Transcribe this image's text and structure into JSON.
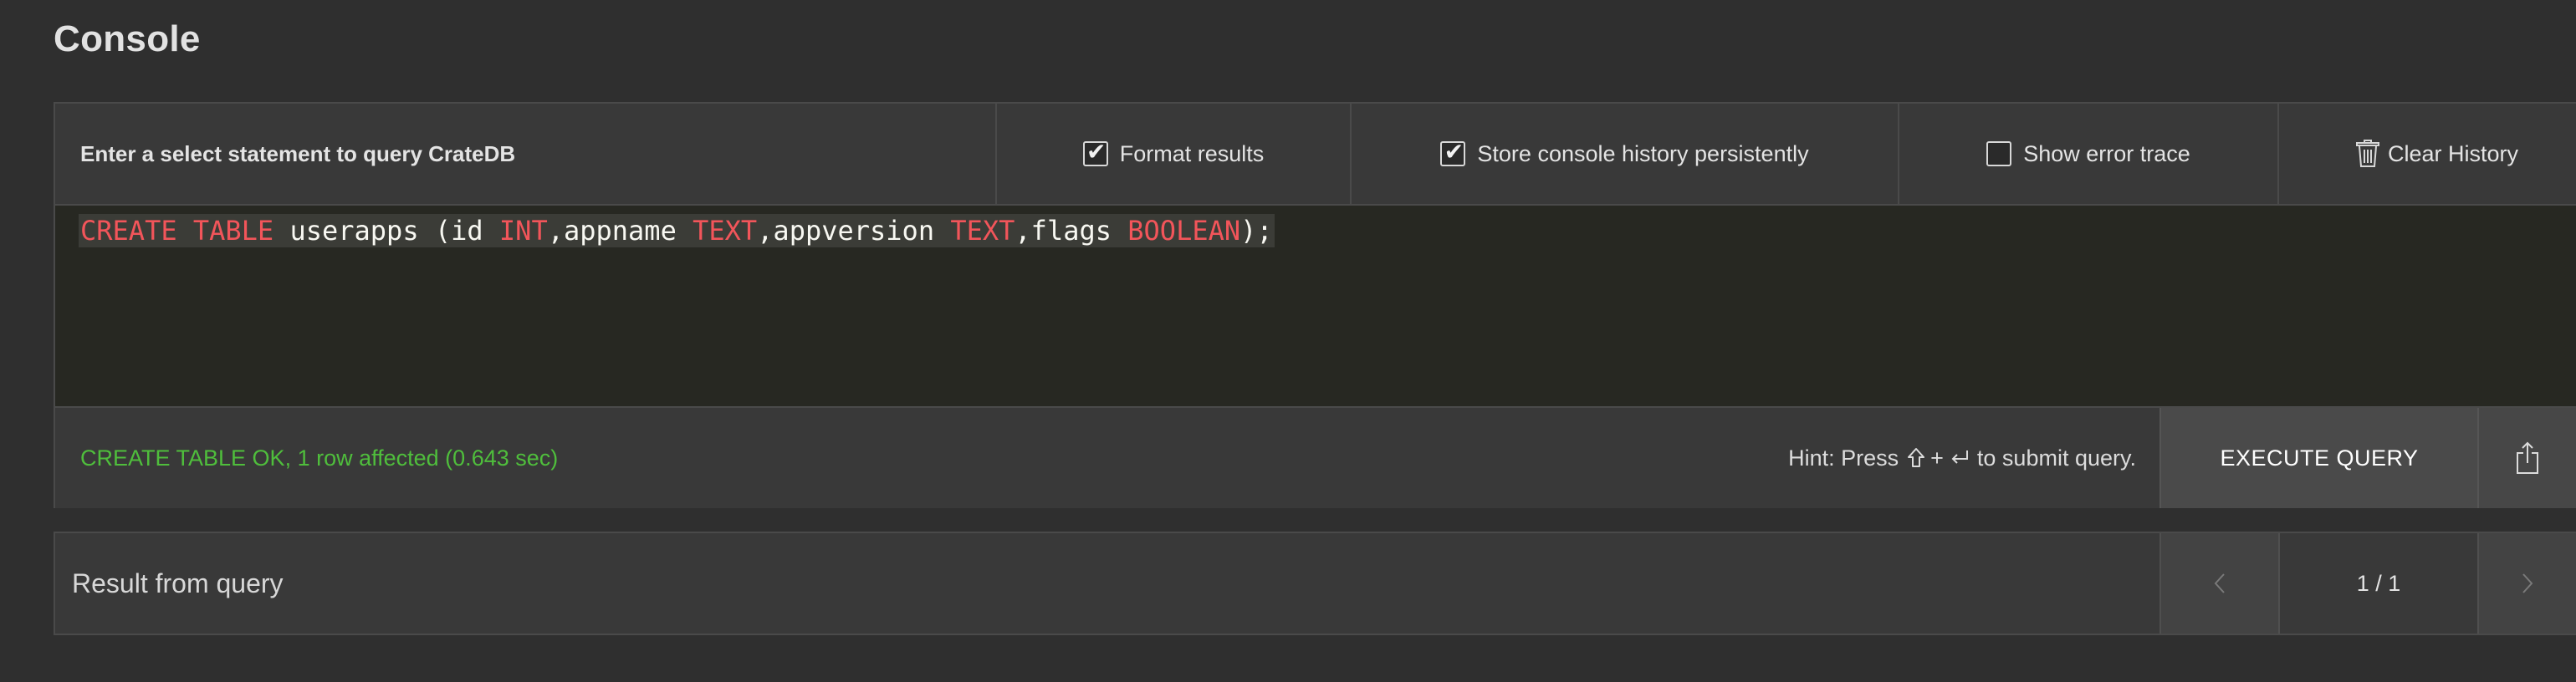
{
  "page": {
    "title": "Console"
  },
  "toolbar": {
    "prompt": "Enter a select statement to query CrateDB",
    "format_results": {
      "label": "Format results",
      "checked": true
    },
    "store_history": {
      "label": "Store console history persistently",
      "checked": true
    },
    "show_error_trace": {
      "label": "Show error trace",
      "checked": false
    },
    "clear_history": {
      "label": "Clear History",
      "icon": "trash-icon"
    }
  },
  "editor": {
    "tokens": [
      {
        "text": "CREATE TABLE",
        "type": "keyword"
      },
      {
        "text": " userapps (id ",
        "type": "plain"
      },
      {
        "text": "INT",
        "type": "keyword"
      },
      {
        "text": ",appname ",
        "type": "plain"
      },
      {
        "text": "TEXT",
        "type": "keyword"
      },
      {
        "text": ",appversion ",
        "type": "plain"
      },
      {
        "text": "TEXT",
        "type": "keyword"
      },
      {
        "text": ",flags ",
        "type": "plain"
      },
      {
        "text": "BOOLEAN",
        "type": "keyword"
      },
      {
        "text": ");",
        "type": "plain"
      }
    ],
    "keyword_color": "#f2555a",
    "background": "#272822"
  },
  "status": {
    "message": "CREATE TABLE OK, 1 row affected (0.643 sec)",
    "message_color": "#4fbe3c",
    "hint_prefix": "Hint: Press",
    "hint_plus": "+",
    "hint_suffix": "to submit query.",
    "shift_icon": "shift-key-icon",
    "enter_icon": "return-key-icon",
    "execute_label": "EXECUTE QUERY",
    "share_icon": "share-icon"
  },
  "result": {
    "title": "Result from query",
    "page_indicator": "1 / 1",
    "prev_icon": "chevron-left-icon",
    "next_icon": "chevron-right-icon"
  }
}
